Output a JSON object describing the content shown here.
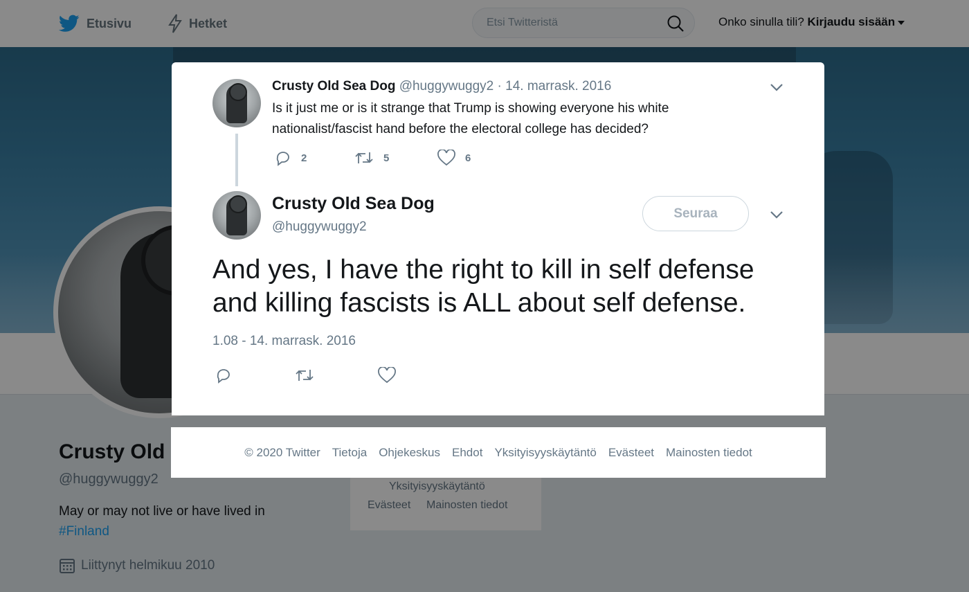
{
  "nav": {
    "home_label": "Etusivu",
    "moments_label": "Hetket",
    "search_placeholder": "Etsi Twitteristä",
    "login_prompt": "Onko sinulla tili?",
    "login_label": "Kirjaudu sisään"
  },
  "profile": {
    "name": "Crusty Old",
    "handle": "@huggywuggy2",
    "bio": "May or may not live or have lived in",
    "bio_hashtag": "#Finland",
    "joined": "Liittynyt helmikuu 2010"
  },
  "background_footer": {
    "privacy": "Yksityisyyskäytäntö",
    "cookies": "Evästeet",
    "ads_info": "Mainosten tiedot"
  },
  "parent_tweet": {
    "author": "Crusty Old Sea Dog",
    "handle": "@huggywuggy2",
    "separator": "·",
    "date": "14. marrask. 2016",
    "text": "Is it just me or is it strange that Trump is showing everyone his white nationalist/fascist hand before the electoral college has decided?",
    "replies": "2",
    "retweets": "5",
    "likes": "6"
  },
  "main_tweet": {
    "author": "Crusty Old Sea Dog",
    "handle": "@huggywuggy2",
    "follow_label": "Seuraa",
    "text": "And yes, I have the right to kill in self defense and killing fascists is ALL about self defense.",
    "timestamp": "1.08 - 14. marrask. 2016"
  },
  "footer": {
    "copyright": "© 2020 Twitter",
    "about": "Tietoja",
    "help": "Ohjekeskus",
    "terms": "Ehdot",
    "privacy": "Yksityisyyskäytäntö",
    "cookies": "Evästeet",
    "ads_info": "Mainosten tiedot"
  },
  "colors": {
    "brand": "#1da1f2",
    "text_primary": "#14171a",
    "text_secondary": "#657786",
    "overlay": "rgba(0,0,0,0.46)"
  }
}
